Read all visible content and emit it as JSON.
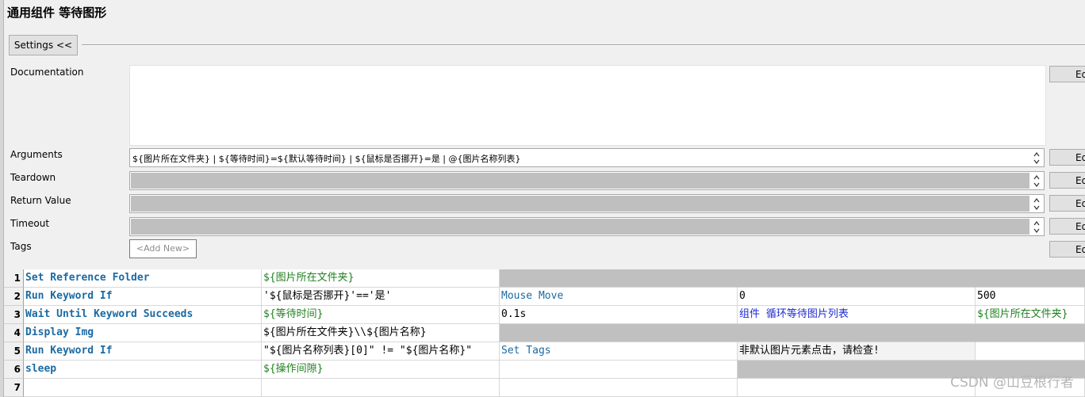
{
  "title": "通用组件 等待图形",
  "settings_button": "Settings <<",
  "edit_label": "Edit",
  "labels": {
    "documentation": "Documentation",
    "arguments": "Arguments",
    "teardown": "Teardown",
    "return_value": "Return Value",
    "timeout": "Timeout",
    "tags": "Tags"
  },
  "arguments_value": "${图片所在文件夹} | ${等待时间}=${默认等待时间} | ${鼠标是否挪开}=是 | @{图片名称列表}",
  "tags_add": "<Add New>",
  "rows": [
    {
      "num": "1",
      "cells": [
        "Set Reference Folder",
        "${图片所在文件夹}",
        "",
        "",
        ""
      ]
    },
    {
      "num": "2",
      "cells": [
        "Run Keyword If",
        "'${鼠标是否挪开}'=='是'",
        "Mouse Move",
        "0",
        "500"
      ]
    },
    {
      "num": "3",
      "cells": [
        "Wait Until Keyword Succeeds",
        "${等待时间}",
        "0.1s",
        "组件 循环等待图片列表",
        "${图片所在文件夹}"
      ]
    },
    {
      "num": "4",
      "cells": [
        "Display Img",
        "${图片所在文件夹}\\\\${图片名称}",
        "",
        "",
        ""
      ]
    },
    {
      "num": "5",
      "cells": [
        "Run Keyword If",
        "\"${图片名称列表}[0]\" != \"${图片名称}\"",
        "Set Tags",
        "非默认图片元素点击，请检查!",
        ""
      ]
    },
    {
      "num": "6",
      "cells": [
        "sleep",
        "${操作间隙}",
        "",
        "",
        ""
      ]
    },
    {
      "num": "7",
      "cells": [
        "",
        "",
        "",
        "",
        ""
      ]
    }
  ],
  "watermark": "CSDN @山豆根行者"
}
